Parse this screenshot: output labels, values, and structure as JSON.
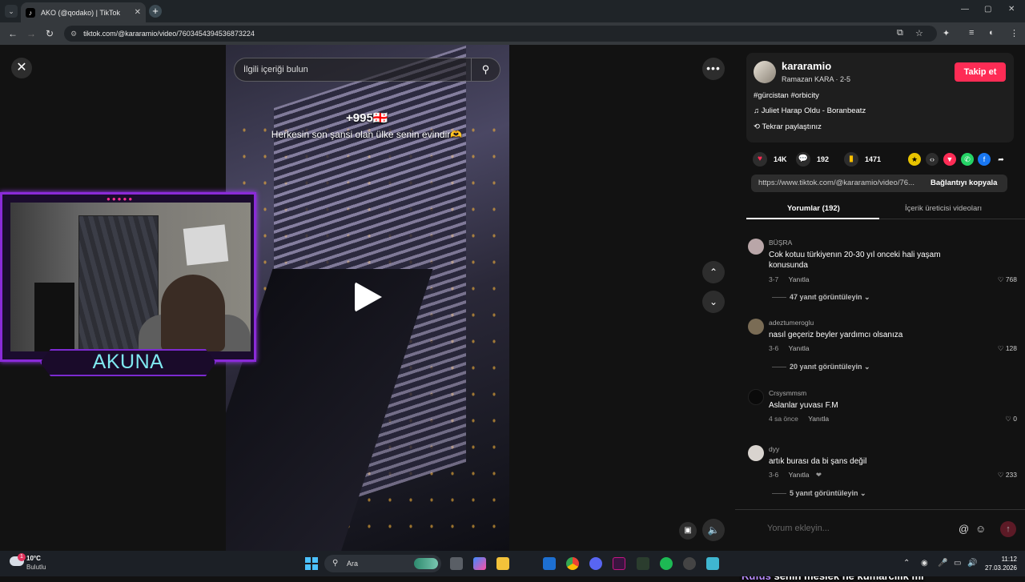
{
  "browser": {
    "tab_title": "AKO (@qodako) | TikTok",
    "tab_favicon": "♪",
    "new_tab": "+",
    "url": "tiktok.com/@kararamio/video/7603454394536873224"
  },
  "video": {
    "search_placeholder": "İlgili içeriği bulun",
    "counter": "+995🇬🇪",
    "caption": "Herkesin son şansi olan ülke senin evindir🫶"
  },
  "webcam": {
    "name": "AKUNA",
    "dots": "●●●●●"
  },
  "creator": {
    "username": "kararamio",
    "sub": "Ramazan KARA · 2-5",
    "follow_label": "Takip et",
    "tags": "#gürcistan #orbicity",
    "music": "♫  Juliet Harap Oldu - Boranbeatz",
    "repost": "Tekrar paylaştınız"
  },
  "actions": {
    "likes": "14K",
    "comments": "192",
    "saves": "1471"
  },
  "link": {
    "url": "https://www.tiktok.com/@kararamio/video/76...",
    "copy_label": "Bağlantıyı kopyala"
  },
  "tabs": {
    "comments": "Yorumlar (192)",
    "creator_videos": "İçerik üreticisi videoları"
  },
  "comments": [
    {
      "user": "BÜŞRA",
      "text": "Cok kotuu türkiyenın 20-30 yıl onceki hali yaşam konusunda",
      "date": "3-7",
      "reply": "Yanıtla",
      "likes": "768",
      "replies": "47 yanıt görüntüleyin",
      "avatar_color": "#b9a6a8"
    },
    {
      "user": "adeztumeroglu",
      "text": "nasıl geçeriz beyler yardımcı olsanıza",
      "date": "3-6",
      "reply": "Yanıtla",
      "likes": "128",
      "replies": "20 yanıt görüntüleyin",
      "avatar_color": "#7a6c55"
    },
    {
      "user": "Crsysmmsm",
      "text": "Aslanlar yuvası F.M",
      "date": "4 sa önce",
      "reply": "Yanıtla",
      "likes": "0",
      "replies": "",
      "avatar_color": "#0a0a0a"
    },
    {
      "user": "dyy",
      "text": "artık burası da bi şans değil",
      "date": "3-6",
      "reply": "Yanıtla",
      "likes": "233",
      "replies": "5 yanıt görüntüleyin",
      "avatar_color": "#d9d4cf"
    }
  ],
  "comment_input": {
    "placeholder": "Yorum ekleyin...",
    "chat_user": "Rufus",
    "chat_text": "senin meslek ne kumarcılık mı"
  },
  "taskbar": {
    "temp": "10°C",
    "weather": "Bulutlu",
    "weather_badge": "1",
    "search_label": "Ara",
    "time": "11:12",
    "date": "27.03.2026"
  }
}
